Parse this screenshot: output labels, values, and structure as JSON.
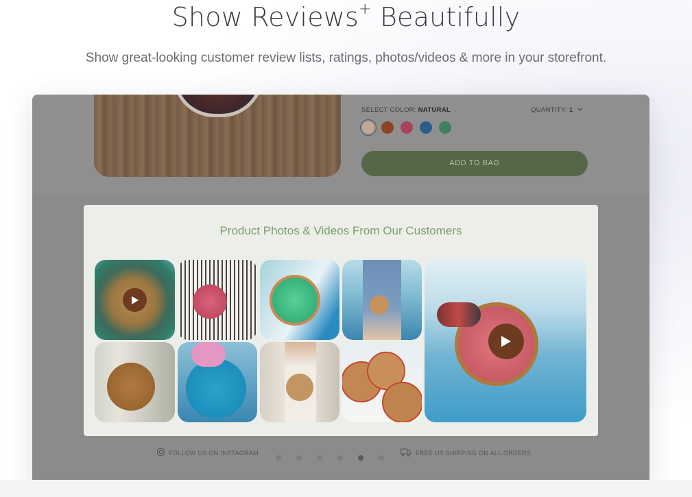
{
  "hero": {
    "title": "Show Reviews",
    "title_sup": "+",
    "title_end": " Beautifully",
    "subtitle": "Show great-looking customer review lists, ratings, photos/videos & more in your storefront."
  },
  "product": {
    "select_color_label": "SELECT COLOR:",
    "select_color_value": "NATURAL",
    "quantity_label": "QUANTITY:",
    "quantity_value": "1",
    "swatch_colors": [
      "#c2a899",
      "#8c4325",
      "#a94359",
      "#2a5f8c",
      "#3e8060"
    ],
    "add_to_bag": "ADD TO BAG"
  },
  "gallery": {
    "title": "Product Photos & Videos From Our Customers"
  },
  "footer": {
    "instagram": "FOLLOW US ON INSTAGRAM",
    "shipping": "FREE US SHIPPING ON ALL ORDERS"
  },
  "colors": {
    "accent_green": "#7e9d70",
    "button_green": "#566747",
    "play_brown": "#6e3b20"
  }
}
